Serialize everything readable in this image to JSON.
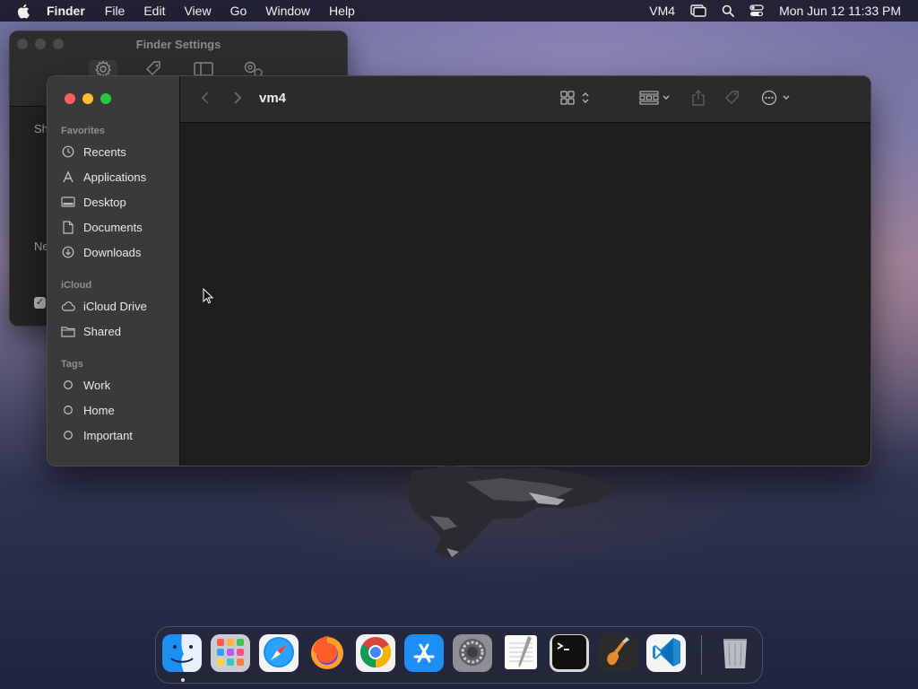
{
  "menubar": {
    "apple_icon": "apple-logo",
    "app_name": "Finder",
    "menus": [
      "File",
      "Edit",
      "View",
      "Go",
      "Window",
      "Help"
    ],
    "status_label": "VM4",
    "clock": "Mon Jun 12  11:33 PM"
  },
  "settings_window": {
    "title": "Finder Settings",
    "tab_icons": [
      "gear-icon",
      "tag-icon",
      "sidebar-icon",
      "advanced-gear-icon"
    ],
    "partial_labels": [
      "Sh",
      "Ne"
    ]
  },
  "finder": {
    "path_title": "vm4",
    "sidebar": {
      "favorites_label": "Favorites",
      "favorites": [
        {
          "label": "Recents",
          "icon": "clock-icon"
        },
        {
          "label": "Applications",
          "icon": "applications-icon"
        },
        {
          "label": "Desktop",
          "icon": "desktop-icon"
        },
        {
          "label": "Documents",
          "icon": "document-icon"
        },
        {
          "label": "Downloads",
          "icon": "download-icon"
        }
      ],
      "icloud_label": "iCloud",
      "icloud": [
        {
          "label": "iCloud Drive",
          "icon": "cloud-icon"
        },
        {
          "label": "Shared",
          "icon": "shared-folder-icon"
        }
      ],
      "tags_label": "Tags",
      "tags": [
        {
          "label": "Work",
          "icon": "tag-circle-icon"
        },
        {
          "label": "Home",
          "icon": "tag-circle-icon"
        },
        {
          "label": "Important",
          "icon": "tag-circle-icon"
        }
      ]
    }
  },
  "dock": {
    "apps": [
      "Finder",
      "Launchpad",
      "Safari",
      "Firefox",
      "Google Chrome",
      "App Store",
      "System Settings",
      "TextEdit",
      "Terminal",
      "GarageBand",
      "Visual Studio Code",
      "Trash"
    ]
  }
}
